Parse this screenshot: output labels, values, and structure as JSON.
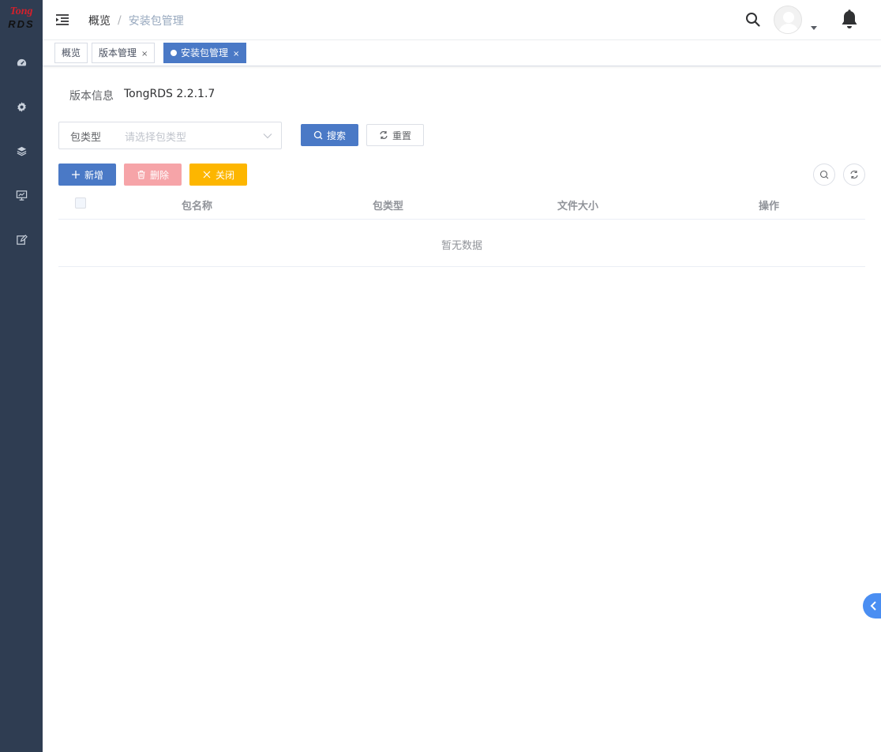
{
  "logo": {
    "line1": "Tong",
    "line2": "RDS"
  },
  "sidebar": {
    "items": [
      {
        "icon": "dashboard-icon"
      },
      {
        "icon": "gear-icon"
      },
      {
        "icon": "layers-icon"
      },
      {
        "icon": "monitor-icon"
      },
      {
        "icon": "edit-icon"
      }
    ]
  },
  "header": {
    "breadcrumb": {
      "first": "概览",
      "separator": "/",
      "current": "安装包管理"
    }
  },
  "tags": [
    {
      "label": "概览",
      "active": false
    },
    {
      "label": "版本管理",
      "close": "×",
      "active": false
    },
    {
      "label": "安装包管理",
      "close": "×",
      "active": true
    }
  ],
  "version": {
    "label": "版本信息",
    "value": "TongRDS 2.2.1.7"
  },
  "filter": {
    "label": "包类型",
    "placeholder": "请选择包类型"
  },
  "buttons": {
    "search": "搜索",
    "reset": "重置",
    "add": "新增",
    "delete": "删除",
    "close": "关闭"
  },
  "table": {
    "columns": [
      "包名称",
      "包类型",
      "文件大小",
      "操作"
    ],
    "empty_text": "暂无数据"
  },
  "colors": {
    "sidebar_bg": "#2f3d52",
    "primary": "#4a79c6",
    "danger_light": "#f6a4a8",
    "warning": "#fdb600"
  }
}
